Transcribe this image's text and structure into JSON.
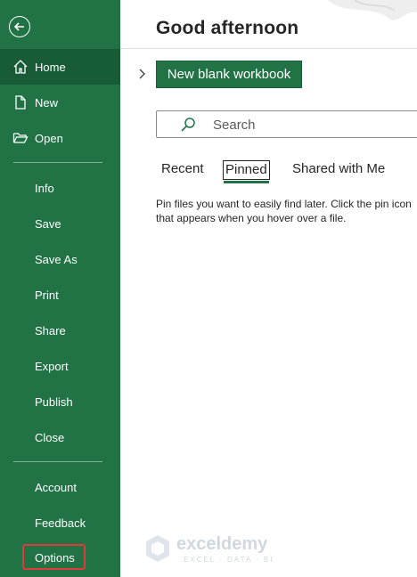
{
  "sidebar": {
    "back_icon": "back-arrow-icon",
    "items": [
      {
        "label": "Home",
        "icon": "home-icon",
        "active": true
      },
      {
        "label": "New",
        "icon": "new-document-icon"
      },
      {
        "label": "Open",
        "icon": "open-folder-icon"
      },
      {
        "label": "Info"
      },
      {
        "label": "Save"
      },
      {
        "label": "Save As"
      },
      {
        "label": "Print"
      },
      {
        "label": "Share"
      },
      {
        "label": "Export"
      },
      {
        "label": "Publish"
      },
      {
        "label": "Close"
      },
      {
        "label": "Account"
      },
      {
        "label": "Feedback"
      },
      {
        "label": "Options",
        "highlighted": true
      }
    ]
  },
  "main": {
    "greeting": "Good afternoon",
    "new_blank_label": "New blank workbook",
    "search_placeholder": "Search",
    "tabs": [
      {
        "label": "Recent"
      },
      {
        "label": "Pinned",
        "selected": true
      },
      {
        "label": "Shared with Me"
      }
    ],
    "pinned_hint": "Pin files you want to easily find later. Click the pin icon that appears when you hover over a file."
  },
  "watermark": {
    "title": "exceldemy",
    "subtitle": "EXCEL · DATA · BI"
  },
  "colors": {
    "brand_green": "#217346",
    "active_green": "#185c37",
    "highlight_red": "#e03a3a"
  }
}
